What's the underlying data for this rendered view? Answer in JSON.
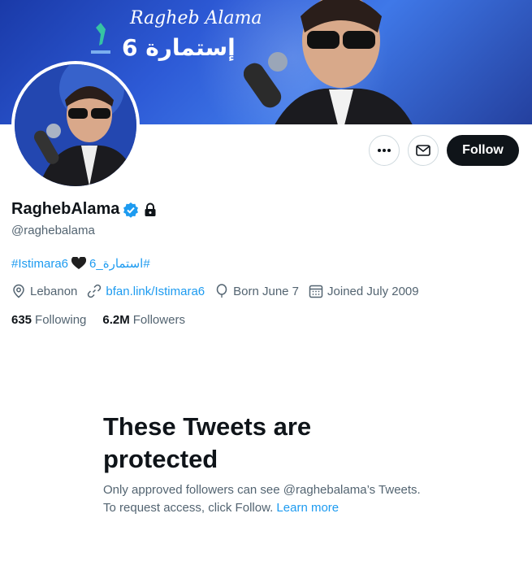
{
  "banner": {
    "signature": "Ragheb Alama",
    "title": "إستمارة 6"
  },
  "profile": {
    "display_name": "RaghebAlama",
    "handle": "@raghebalama",
    "bio": {
      "tag1": "#Istimara6",
      "tag2": "#استمارة_6"
    },
    "location": "Lebanon",
    "website": "bfan.link/Istimara6",
    "born": "Born June 7",
    "joined": "Joined July 2009",
    "following_count": "635",
    "following_label": "Following",
    "followers_count": "6.2M",
    "followers_label": "Followers"
  },
  "actions": {
    "more": "•••",
    "follow_label": "Follow"
  },
  "protected": {
    "title": "These Tweets are protected",
    "body": "Only approved followers can see @raghebalama’s Tweets. To request access, click Follow.",
    "learn_more": "Learn more"
  },
  "colors": {
    "accent": "#1d9bf0",
    "text_primary": "#0f1419",
    "text_secondary": "#536471",
    "follow_bg": "#0f1419"
  },
  "icons": [
    "verified-icon",
    "lock-icon",
    "heart-icon",
    "location-icon",
    "link-icon",
    "balloon-icon",
    "calendar-icon",
    "mail-icon",
    "more-icon"
  ]
}
